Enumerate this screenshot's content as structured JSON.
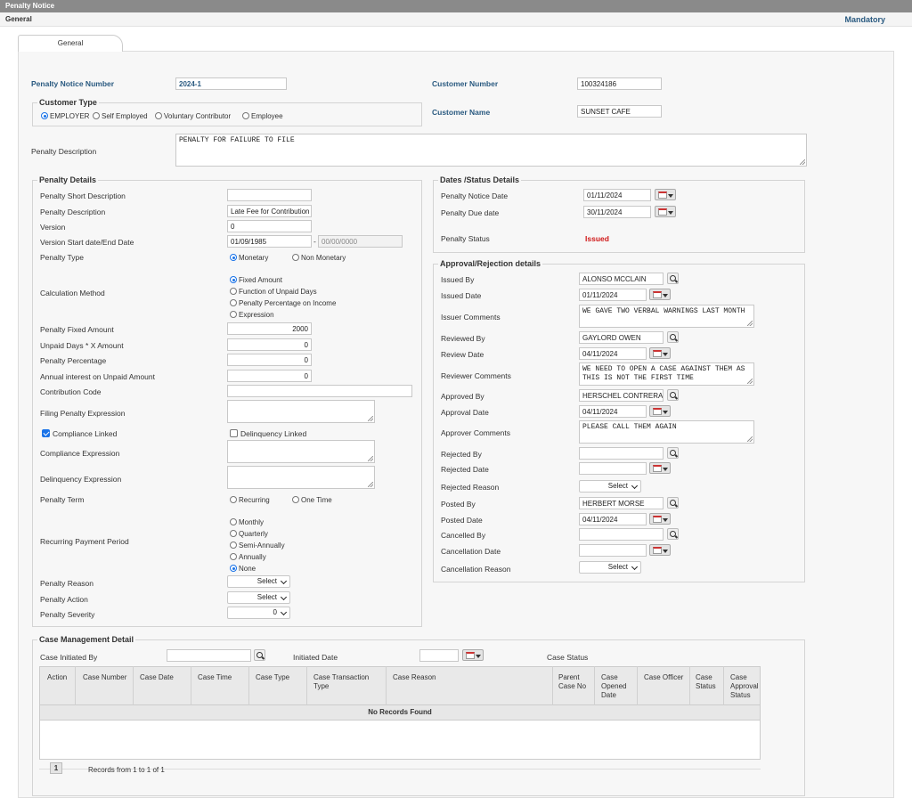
{
  "window": {
    "title": "Penalty Notice",
    "section": "General",
    "mandatory": "Mandatory"
  },
  "tabs": [
    {
      "label": "General"
    }
  ],
  "header": {
    "penalty_notice_number_label": "Penalty Notice Number",
    "penalty_notice_number": "2024-1",
    "customer_number_label": "Customer Number",
    "customer_number": "100324186",
    "customer_name_label": "Customer Name",
    "customer_name": "SUNSET CAFE",
    "customer_type_legend": "Customer Type",
    "customer_types": [
      "EMPLOYER",
      "Self Employed",
      "Voluntary Contributor",
      "Employee"
    ],
    "customer_type_selected": "EMPLOYER",
    "penalty_description_label": "Penalty Description",
    "penalty_description": "PENALTY FOR FAILURE TO FILE"
  },
  "penalty_details": {
    "legend": "Penalty Details",
    "short_description_label": "Penalty Short Description",
    "short_description": "",
    "description_label": "Penalty Description",
    "description": "Late Fee for Contribution R",
    "version_label": "Version",
    "version": "0",
    "version_dates_label": "Version Start date/End Date",
    "version_start": "01/09/1985",
    "dash": "-",
    "version_end": "00/00/0000",
    "penalty_type_label": "Penalty Type",
    "penalty_types": [
      "Monetary",
      "Non Monetary"
    ],
    "calculation_method_label": "Calculation Method",
    "calculation_methods": [
      "Fixed Amount",
      "Function of Unpaid Days",
      "Penalty Percentage on Income",
      "Expression"
    ],
    "fixed_amount_label": "Penalty Fixed Amount",
    "fixed_amount": "2000",
    "unpaid_days_label": "Unpaid Days * X Amount",
    "unpaid_days": "0",
    "percentage_label": "Penalty Percentage",
    "percentage": "0",
    "annual_interest_label": "Annual interest on Unpaid Amount",
    "annual_interest": "0",
    "contribution_code_label": "Contribution Code",
    "contribution_code": "",
    "filing_expression_label": "Filing Penalty Expression",
    "compliance_linked_label": "Compliance Linked",
    "delinquency_linked_label": "Delinquency Linked",
    "compliance_expression_label": "Compliance Expression",
    "delinquency_expression_label": "Delinquency Expression",
    "penalty_term_label": "Penalty Term",
    "penalty_terms": [
      "Recurring",
      "One Time"
    ],
    "recurring_period_label": "Recurring Payment Period",
    "recurring_periods": [
      "Monthly",
      "Quarterly",
      "Semi-Annually",
      "Annually",
      "None"
    ],
    "penalty_reason_label": "Penalty Reason",
    "penalty_reason": "Select",
    "penalty_action_label": "Penalty Action",
    "penalty_action": "Select",
    "penalty_severity_label": "Penalty Severity",
    "penalty_severity": "0"
  },
  "dates_status": {
    "legend": "Dates /Status Details",
    "notice_date_label": "Penalty Notice Date",
    "notice_date": "01/11/2024",
    "due_date_label": "Penalty Due date",
    "due_date": "30/11/2024",
    "status_label": "Penalty Status",
    "status": "Issued",
    "status_color": "#d01818"
  },
  "approval": {
    "legend": "Approval/Rejection details",
    "issued_by_label": "Issued By",
    "issued_by": "ALONSO MCCLAIN",
    "issued_date_label": "Issued Date",
    "issued_date": "01/11/2024",
    "issuer_comments_label": "Issuer Comments",
    "issuer_comments": "WE GAVE TWO VERBAL WARNINGS LAST MONTH",
    "reviewed_by_label": "Reviewed By",
    "reviewed_by": "GAYLORD OWEN",
    "review_date_label": "Review Date",
    "review_date": "04/11/2024",
    "reviewer_comments_label": "Reviewer Comments",
    "reviewer_comments": "WE NEED TO OPEN A CASE AGAINST THEM AS THIS IS NOT THE FIRST TIME",
    "approved_by_label": "Approved By",
    "approved_by": "HERSCHEL CONTRERAS",
    "approval_date_label": "Approval Date",
    "approval_date": "04/11/2024",
    "approver_comments_label": "Approver Comments",
    "approver_comments": "PLEASE CALL THEM AGAIN",
    "rejected_by_label": "Rejected By",
    "rejected_by": "",
    "rejected_date_label": "Rejected Date",
    "rejected_date": "",
    "rejected_reason_label": "Rejected Reason",
    "rejected_reason": "Select",
    "posted_by_label": "Posted By",
    "posted_by": "HERBERT MORSE",
    "posted_date_label": "Posted Date",
    "posted_date": "04/11/2024",
    "cancelled_by_label": "Cancelled By",
    "cancelled_by": "",
    "cancellation_date_label": "Cancellation Date",
    "cancellation_date": "",
    "cancellation_reason_label": "Cancellation Reason",
    "cancellation_reason": "Select"
  },
  "case_management": {
    "legend": "Case Management Detail",
    "initiated_by_label": "Case Initiated By",
    "initiated_by": "",
    "initiated_date_label": "Initiated Date",
    "initiated_date": "",
    "case_status_label": "Case Status",
    "columns": [
      "Action",
      "Case Number",
      "Case Date",
      "Case Time",
      "Case Type",
      "Case Transaction Type",
      "Case Reason",
      "Parent Case No",
      "Case Opened Date",
      "Case Officer",
      "Case Status",
      "Case Approval Status"
    ],
    "empty_message": "No Records Found",
    "page": "1",
    "records_text": "Records from 1 to 1 of 1"
  }
}
